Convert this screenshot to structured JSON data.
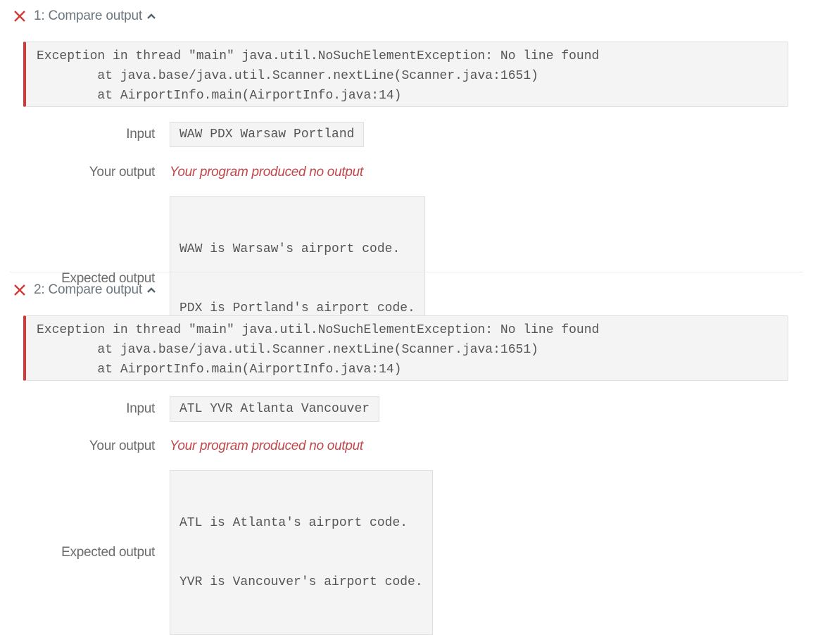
{
  "tests": [
    {
      "title": "1: Compare output",
      "status_icon": "x-icon",
      "toggle_icon": "chevron-up-icon",
      "error": [
        "Exception in thread \"main\" java.util.NoSuchElementException: No line found",
        "        at java.base/java.util.Scanner.nextLine(Scanner.java:1651)",
        "        at AirportInfo.main(AirportInfo.java:14)"
      ],
      "input_label": "Input",
      "input_value": "WAW PDX Warsaw Portland",
      "your_output_label": "Your output",
      "your_output_value": "Your program produced no output",
      "expected_label": "Expected output",
      "expected_lines": [
        "WAW is Warsaw's airport code.",
        "PDX is Portland's airport code."
      ]
    },
    {
      "title": "2: Compare output",
      "status_icon": "x-icon",
      "toggle_icon": "chevron-up-icon",
      "error": [
        "Exception in thread \"main\" java.util.NoSuchElementException: No line found",
        "        at java.base/java.util.Scanner.nextLine(Scanner.java:1651)",
        "        at AirportInfo.main(AirportInfo.java:14)"
      ],
      "input_label": "Input",
      "input_value": "ATL YVR Atlanta Vancouver",
      "your_output_label": "Your output",
      "your_output_value": "Your program produced no output",
      "expected_label": "Expected output",
      "expected_lines": [
        "ATL is Atlanta's airport code.",
        "YVR is Vancouver's airport code."
      ]
    }
  ],
  "colors": {
    "fail": "#d23a3a",
    "no_output": "#c0484b"
  }
}
